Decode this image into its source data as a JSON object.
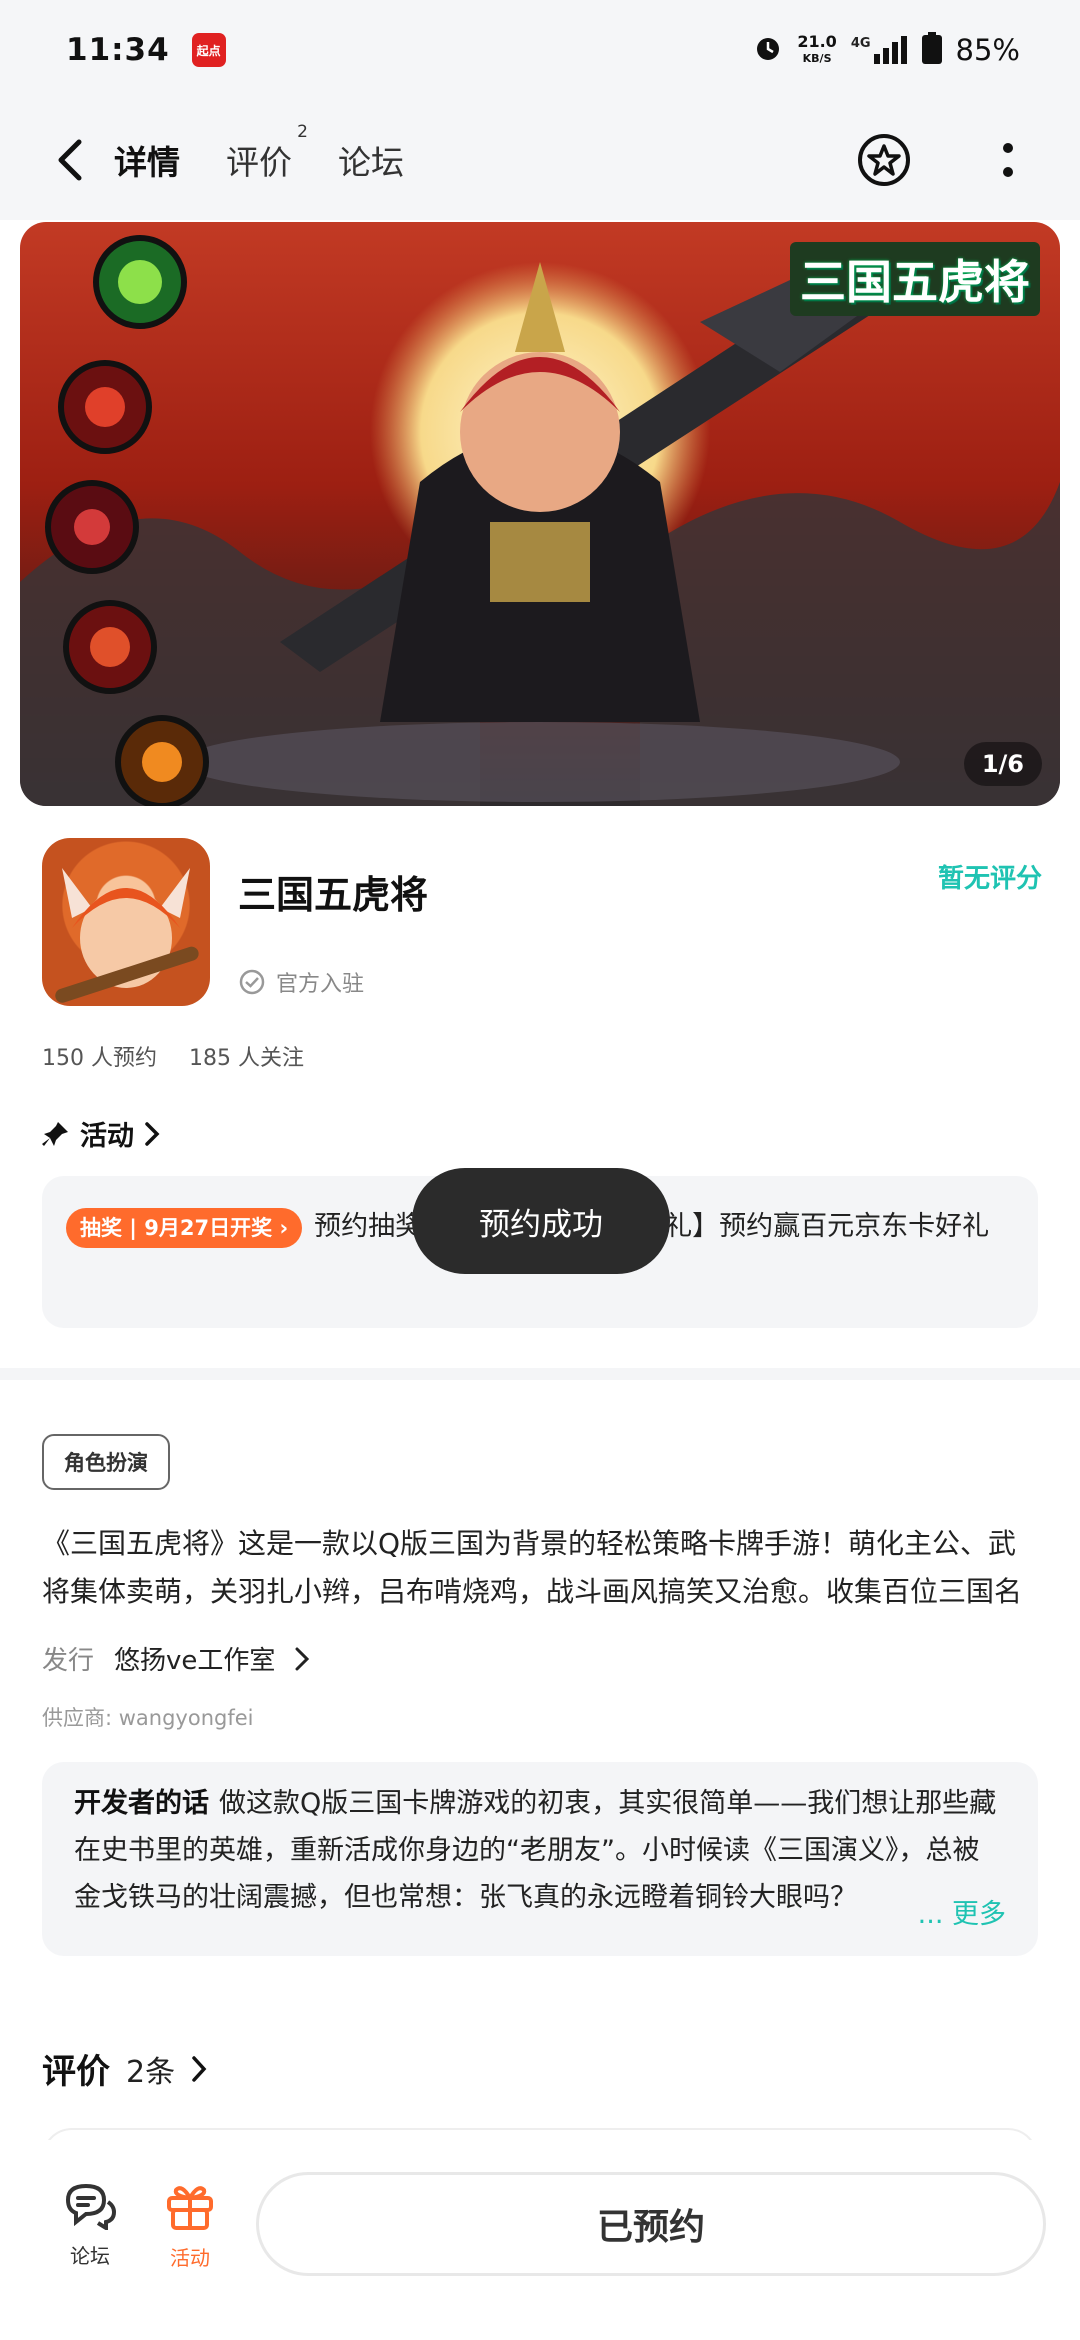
{
  "status_bar": {
    "time": "11:34",
    "app_badge": "起点",
    "speed_value": "21.0",
    "speed_unit": "KB/S",
    "network": "4G",
    "battery": "85%"
  },
  "nav": {
    "tabs": [
      {
        "label": "详情",
        "active": true
      },
      {
        "label": "评价",
        "badge": "2"
      },
      {
        "label": "论坛"
      }
    ]
  },
  "banner": {
    "title": "三国五虎将",
    "counter": "1/6"
  },
  "app": {
    "name": "三国五虎将",
    "official_label": "官方入驻",
    "rating_text": "暂无评分",
    "reservations": "150 人预约",
    "followers": "185 人关注"
  },
  "activity": {
    "heading": "活动",
    "badge_type": "抽奖",
    "badge_date": "9月27日开奖",
    "text": "预约抽奖【三国五虎将预约好礼】预约赢百元京东卡好礼"
  },
  "toast": "预约成功",
  "detail": {
    "genre_tag": "角色扮演",
    "description": "《三国五虎将》这是一款以Q版三国为背景的轻松策略卡牌手游！萌化主公、武将集体卖萌，关羽扎小辫，吕布啃烧鸡，战斗画风搞笑又治愈。收集百位三国名将，自由搭配阵容，轻松挂机即可成长。",
    "publisher_label": "发行",
    "publisher_name": "悠扬ve工作室",
    "supplier": "供应商: wangyongfei",
    "dev_words_label": "开发者的话",
    "dev_words_text": "做这款Q版三国卡牌游戏的初衷，其实很简单——我们想让那些藏在史书里的英雄，重新活成你身边的“老朋友”。小时候读《三国演义》，总被金戈铁马的壮阔震撼，但也常想：张飞真的永远瞪着铜铃大眼吗？",
    "more": "更多"
  },
  "reviews": {
    "title": "评价",
    "count": "2条"
  },
  "bottom_bar": {
    "forum_label": "论坛",
    "activity_label": "活动",
    "reserve_button": "已预约"
  },
  "colors": {
    "accent": "#1fc3b2",
    "orange": "#ff6b2c",
    "toast_bg": "#2b2b2b"
  }
}
